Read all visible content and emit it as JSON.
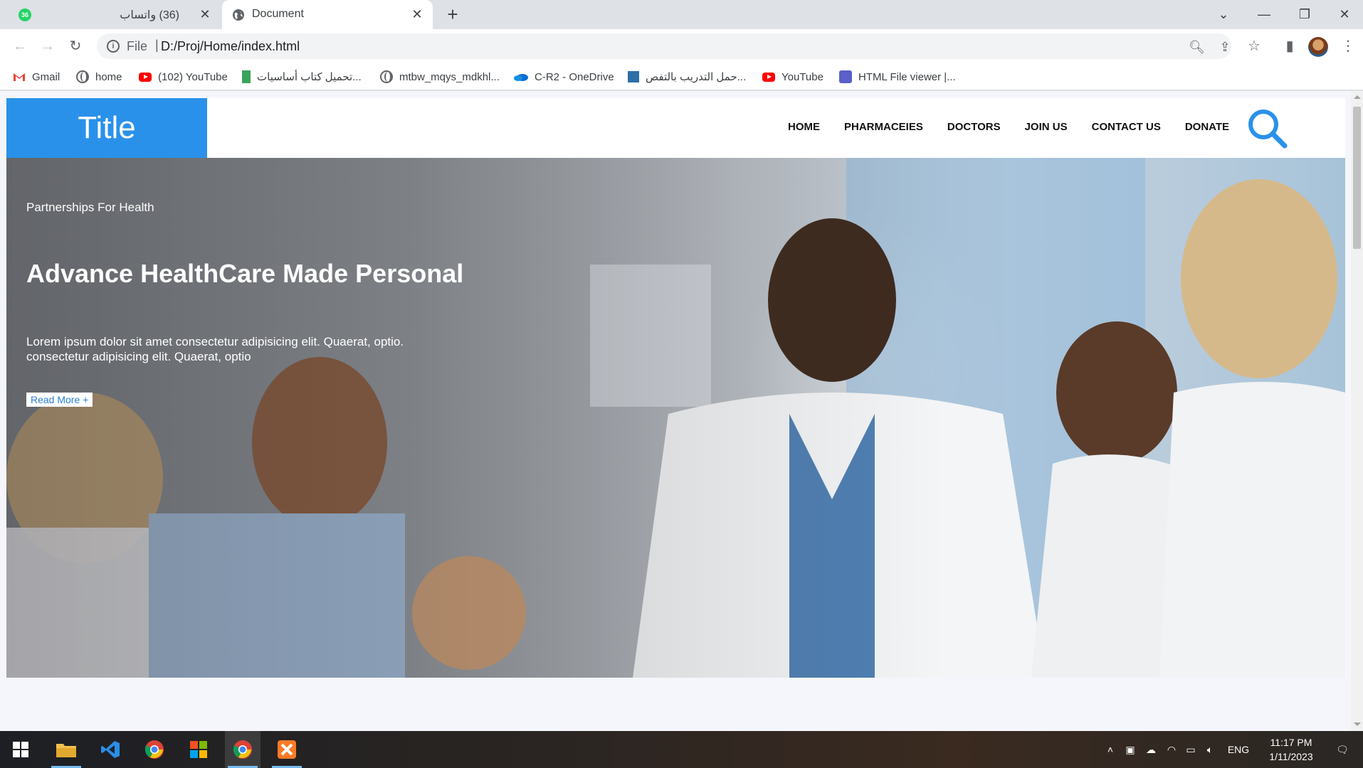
{
  "browser": {
    "tabs": [
      {
        "title": "(36) واتساب",
        "badge": "36",
        "active": false
      },
      {
        "title": "Document",
        "active": true
      }
    ],
    "omnibox": {
      "scheme": "File",
      "separator": "|",
      "url": "D:/Proj/Home/index.html"
    },
    "bookmarks": [
      {
        "label": "Gmail",
        "icon": "gmail-icon"
      },
      {
        "label": "home",
        "icon": "globe-icon"
      },
      {
        "label": "(102) YouTube",
        "icon": "youtube-icon"
      },
      {
        "label": "تحميل كتاب أساسيات...",
        "icon": "book-icon"
      },
      {
        "label": "mtbw_mqys_mdkhl...",
        "icon": "globe-icon"
      },
      {
        "label": "C-R2 - OneDrive",
        "icon": "onedrive-icon"
      },
      {
        "label": "حمل التدريب بالتفص...",
        "icon": "doc-icon"
      },
      {
        "label": "YouTube",
        "icon": "youtube-icon"
      },
      {
        "label": "HTML File viewer |...",
        "icon": "teams-icon"
      }
    ]
  },
  "site": {
    "logo": "Title",
    "nav": [
      "HOME",
      "PHARMACEIES",
      "DOCTORS",
      "JOIN US",
      "CONTACT US",
      "DONATE"
    ],
    "hero": {
      "kicker": "Partnerships For Health",
      "title": "Advance HealthCare Made Personal",
      "text": "Lorem ipsum dolor sit amet consectetur adipisicing elit. Quaerat, optio. consectetur adipisicing elit. Quaerat, optio",
      "button": "Read More +"
    }
  },
  "taskbar": {
    "apps": [
      "windows-start",
      "file-explorer",
      "vscode",
      "chrome",
      "microsoft-store",
      "chrome-active",
      "xampp"
    ],
    "tray": {
      "lang": "ENG",
      "time": "11:17 PM",
      "date": "1/11/2023"
    }
  },
  "colors": {
    "accent": "#2a91ea",
    "tabbar": "#dee1e6",
    "taskbar": "#1d1f24"
  }
}
